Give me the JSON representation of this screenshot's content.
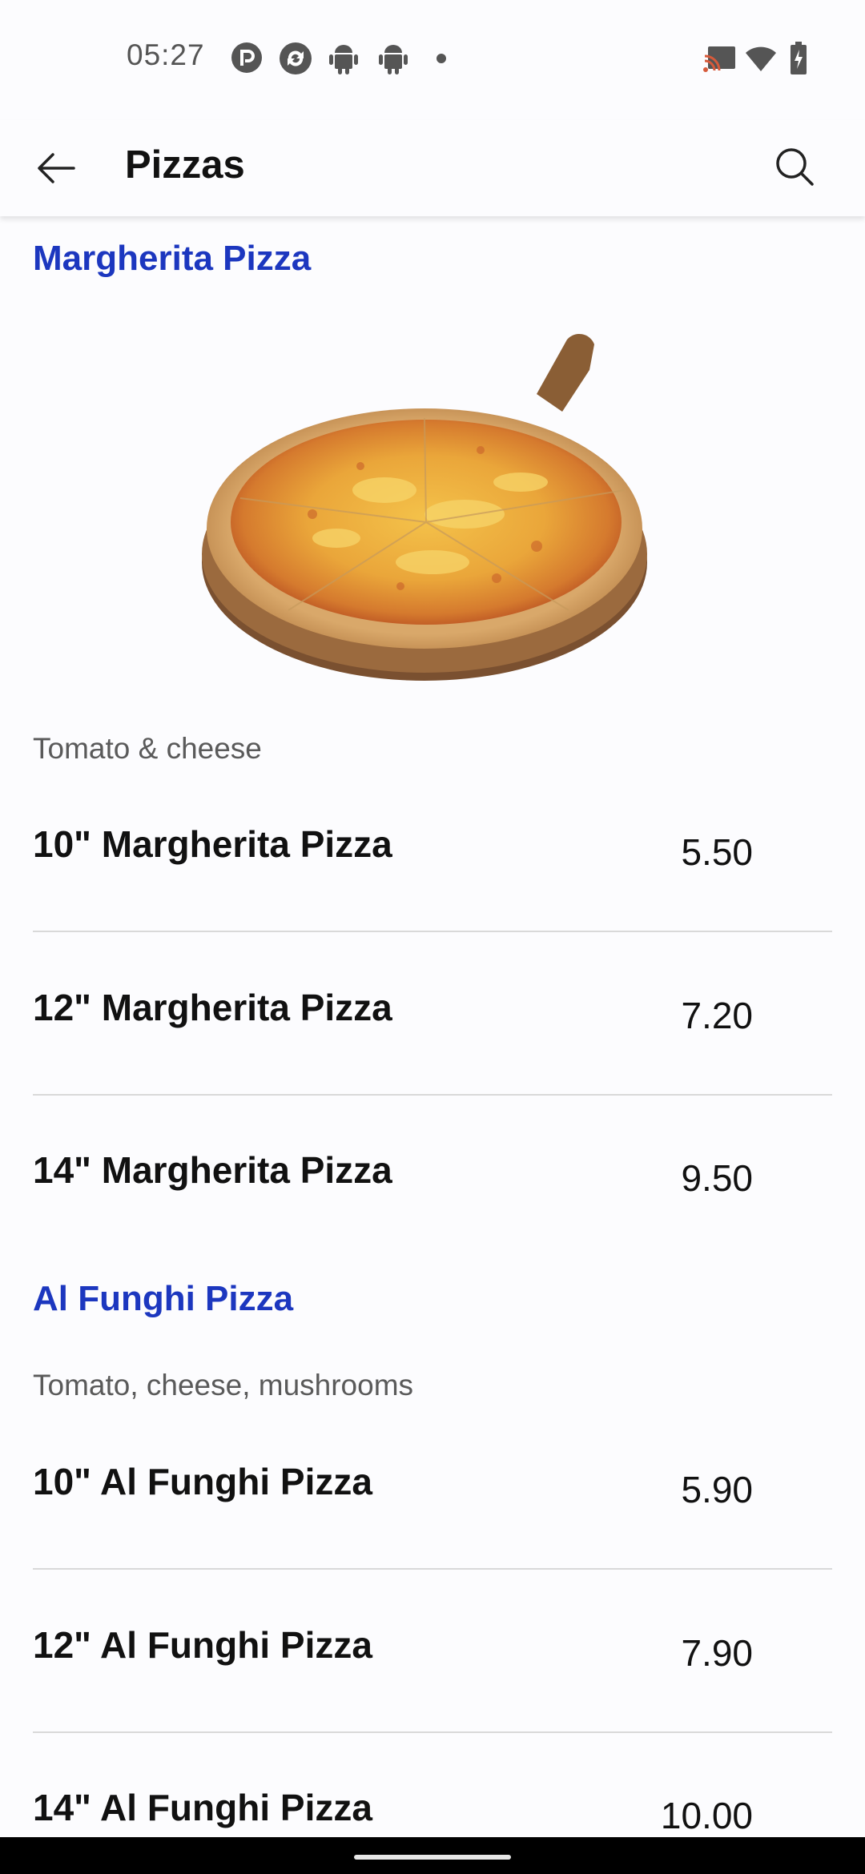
{
  "status_bar": {
    "time": "05:27",
    "left_icons": [
      "pocket-casts-icon",
      "sync-app-icon",
      "android-icon",
      "android-icon",
      "dot-icon"
    ],
    "right_icons": [
      "cast-icon",
      "wifi-icon",
      "battery-charging-icon"
    ]
  },
  "app_bar": {
    "title": "Pizzas",
    "back_icon": "arrow-left-icon",
    "search_icon": "search-icon"
  },
  "sections": [
    {
      "title": "Margherita Pizza",
      "description": "Tomato & cheese",
      "items": [
        {
          "name": "10\" Margherita Pizza",
          "price": "5.50"
        },
        {
          "name": "12\" Margherita Pizza",
          "price": "7.20"
        },
        {
          "name": "14\" Margherita Pizza",
          "price": "9.50"
        }
      ]
    },
    {
      "title": "Al Funghi Pizza",
      "description": "Tomato, cheese, mushrooms",
      "items": [
        {
          "name": "10\" Al Funghi Pizza",
          "price": "5.90"
        },
        {
          "name": "12\" Al Funghi Pizza",
          "price": "7.90"
        },
        {
          "name": "14\" Al Funghi Pizza",
          "price": "10.00"
        }
      ]
    }
  ],
  "colors": {
    "section_title": "#1c37bf",
    "background": "#fcfcfe",
    "divider": "#d9d9d9"
  }
}
